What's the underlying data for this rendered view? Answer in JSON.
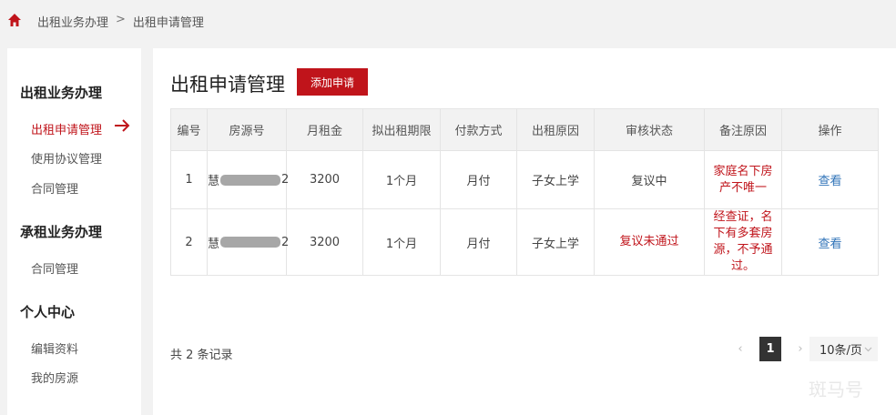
{
  "breadcrumb": {
    "items": [
      "出租业务办理",
      "出租申请管理"
    ],
    "separator": ">"
  },
  "sidebar": {
    "groups": [
      {
        "title": "出租业务办理",
        "items": [
          "出租申请管理",
          "使用协议管理",
          "合同管理"
        ]
      },
      {
        "title": "承租业务办理",
        "items": [
          "合同管理"
        ]
      },
      {
        "title": "个人中心",
        "items": [
          "编辑资料",
          "我的房源"
        ]
      }
    ],
    "active_item": "出租申请管理"
  },
  "main": {
    "title": "出租申请管理",
    "add_button": "添加申请",
    "table": {
      "headers": [
        "编号",
        "房源号",
        "月租金",
        "拟出租期限",
        "付款方式",
        "出租原因",
        "审核状态",
        "备注原因",
        "操作"
      ],
      "rows": [
        {
          "id": "1",
          "house_prefix": "慧",
          "house_suffix": "2",
          "rent": "3200",
          "term": "1个月",
          "payment": "月付",
          "reason": "子女上学",
          "status": "复议中",
          "remark": "家庭名下房产不唯一",
          "action": "查看"
        },
        {
          "id": "2",
          "house_prefix": "慧",
          "house_suffix": "2",
          "rent": "3200",
          "term": "1个月",
          "payment": "月付",
          "reason": "子女上学",
          "status": "复议未通过",
          "remark": "经查证，名下有多套房源，不予通过。",
          "action": "查看"
        }
      ]
    },
    "total_text": "共 2 条记录",
    "pagination": {
      "prev": "‹",
      "current": "1",
      "next": "›",
      "page_size": "10条/页"
    }
  },
  "watermark": "斑马号",
  "colors": {
    "accent": "#c0141b",
    "link": "#2f73b8",
    "background": "#f2f2f2"
  },
  "icons": {
    "home": "home-icon",
    "active_arrow": "arrow-right-icon",
    "dropdown": "chevron-down-icon"
  }
}
